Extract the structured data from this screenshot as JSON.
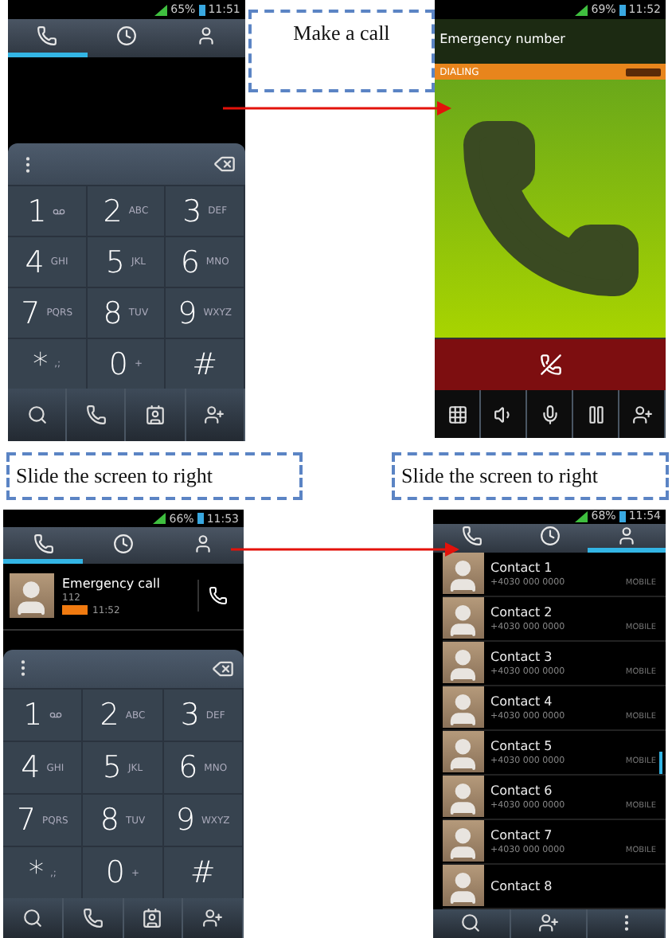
{
  "make_call_note": "Make a call",
  "slide_notes": [
    "Slide the screen to right",
    "Slide the screen to right"
  ],
  "screens": [
    {
      "kind": "dialer",
      "status": {
        "battery": "65%",
        "time": "11:51"
      },
      "tabs": [
        {
          "kind": "phone",
          "selected": true
        },
        {
          "kind": "clock",
          "selected": false
        },
        {
          "kind": "person",
          "selected": false
        }
      ],
      "keys": [
        {
          "digit": "1",
          "kind": "voicemail"
        },
        {
          "digit": "2",
          "letters": "ABC"
        },
        {
          "digit": "3",
          "letters": "DEF"
        },
        {
          "digit": "4",
          "letters": "GHI"
        },
        {
          "digit": "5",
          "letters": "JKL"
        },
        {
          "digit": "6",
          "letters": "MNO"
        },
        {
          "digit": "7",
          "letters": "PQRS"
        },
        {
          "digit": "8",
          "letters": "TUV"
        },
        {
          "digit": "9",
          "letters": "WXYZ"
        },
        {
          "digit": "*",
          "letters": ",;"
        },
        {
          "digit": "0",
          "letters": "+"
        },
        {
          "digit": "#"
        }
      ],
      "actions": [
        {
          "kind": "search"
        },
        {
          "kind": "call"
        },
        {
          "kind": "contact_card"
        },
        {
          "kind": "add_contact"
        }
      ]
    },
    {
      "kind": "in_call",
      "status": {
        "battery": "69%",
        "time": "11:52"
      },
      "title": "Emergency number",
      "state": "DIALING",
      "actions": [
        {
          "kind": "dialpad"
        },
        {
          "kind": "speaker"
        },
        {
          "kind": "mic"
        },
        {
          "kind": "pause"
        },
        {
          "kind": "add_contact"
        }
      ]
    },
    {
      "kind": "dialer",
      "status": {
        "battery": "66%",
        "time": "11:53"
      },
      "tabs": [
        {
          "kind": "phone",
          "selected": true
        },
        {
          "kind": "clock",
          "selected": false
        },
        {
          "kind": "person",
          "selected": false
        }
      ],
      "recent": {
        "name": "Emergency call",
        "number": "112",
        "time": "11:52"
      },
      "keys": [
        {
          "digit": "1",
          "kind": "voicemail"
        },
        {
          "digit": "2",
          "letters": "ABC"
        },
        {
          "digit": "3",
          "letters": "DEF"
        },
        {
          "digit": "4",
          "letters": "GHI"
        },
        {
          "digit": "5",
          "letters": "JKL"
        },
        {
          "digit": "6",
          "letters": "MNO"
        },
        {
          "digit": "7",
          "letters": "PQRS"
        },
        {
          "digit": "8",
          "letters": "TUV"
        },
        {
          "digit": "9",
          "letters": "WXYZ"
        },
        {
          "digit": "*",
          "letters": ",;"
        },
        {
          "digit": "0",
          "letters": "+"
        },
        {
          "digit": "#"
        }
      ],
      "actions": [
        {
          "kind": "search"
        },
        {
          "kind": "call"
        },
        {
          "kind": "contact_card"
        },
        {
          "kind": "add_contact"
        }
      ]
    },
    {
      "kind": "contacts",
      "status": {
        "battery": "68%",
        "time": "11:54"
      },
      "tabs": [
        {
          "kind": "phone",
          "selected": false
        },
        {
          "kind": "clock",
          "selected": false
        },
        {
          "kind": "person",
          "selected": true
        }
      ],
      "contacts": [
        {
          "name": "Contact 1",
          "number": "+4030 000 0000",
          "type": "MOBILE"
        },
        {
          "name": "Contact 2",
          "number": "+4030 000 0000",
          "type": "MOBILE"
        },
        {
          "name": "Contact 3",
          "number": "+4030 000 0000",
          "type": "MOBILE"
        },
        {
          "name": "Contact 4",
          "number": "+4030 000 0000",
          "type": "MOBILE"
        },
        {
          "name": "Contact 5",
          "number": "+4030 000 0000",
          "type": "MOBILE"
        },
        {
          "name": "Contact 6",
          "number": "+4030 000 0000",
          "type": "MOBILE"
        },
        {
          "name": "Contact 7",
          "number": "+4030 000 0000",
          "type": "MOBILE"
        },
        {
          "name": "Contact 8"
        }
      ],
      "actions": [
        {
          "kind": "search"
        },
        {
          "kind": "add_contact"
        },
        {
          "kind": "menu"
        }
      ]
    }
  ]
}
